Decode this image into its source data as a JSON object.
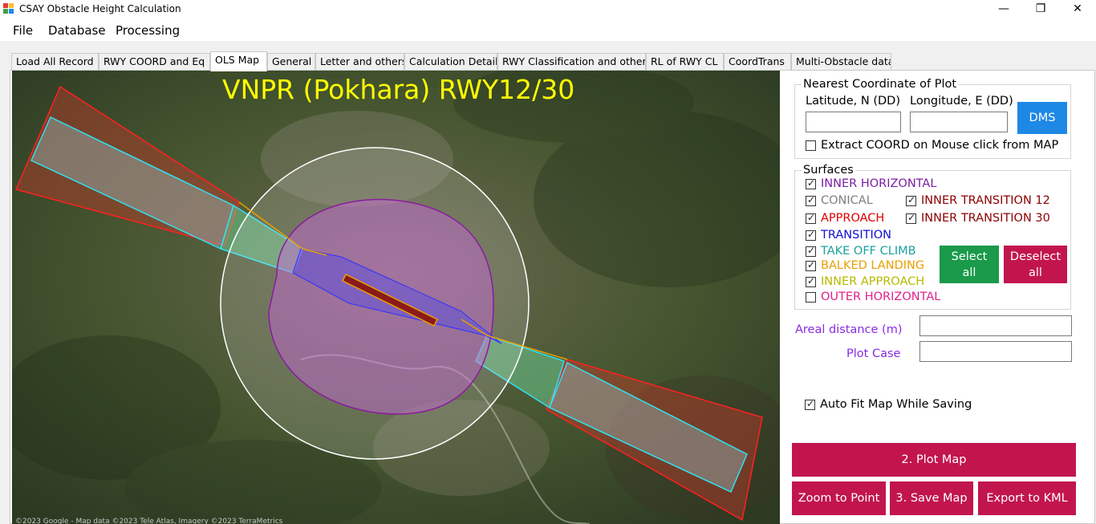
{
  "window": {
    "title": "CSAY Obstacle Height Calculation",
    "controls": {
      "minimize": "—",
      "maximize": "❐",
      "close": "✕"
    }
  },
  "menu": [
    "File",
    "Database",
    "Processing"
  ],
  "tabs": [
    "Load All Record",
    "RWY COORD and Eq",
    "OLS Map",
    "General",
    "Letter and others",
    "Calculation Detail",
    "RWY Classification and other",
    "RL of RWY CL",
    "CoordTrans",
    "Multi-Obstacle data"
  ],
  "active_tab": "OLS Map",
  "map": {
    "title": "VNPR (Pokhara) RWY12/30",
    "credit": "©2023 Google - Map data ©2023 Tele Atlas, Imagery ©2023 TerraMetrics"
  },
  "nearest": {
    "group_label": "Nearest Coordinate of Plot",
    "lat_label": "Latitude, N (DD)",
    "lon_label": "Longitude, E (DD)",
    "lat_value": "",
    "lon_value": "",
    "dms_button": "DMS",
    "extract_label": "Extract COORD on Mouse click from MAP",
    "extract_checked": false
  },
  "surfaces": {
    "group_label": "Surfaces",
    "items": [
      {
        "label": "INNER HORIZONTAL",
        "checked": true,
        "color": "#7a1fa2"
      },
      {
        "label": "CONICAL",
        "checked": true,
        "color": "#808080"
      },
      {
        "label": "INNER TRANSITION 12",
        "checked": true,
        "color": "#8b0000"
      },
      {
        "label": "APPROACH",
        "checked": true,
        "color": "#e00000"
      },
      {
        "label": "INNER TRANSITION 30",
        "checked": true,
        "color": "#8b0000"
      },
      {
        "label": "TRANSITION",
        "checked": true,
        "color": "#1010d0"
      },
      {
        "label": "TAKE OFF CLIMB",
        "checked": true,
        "color": "#1ea0a0"
      },
      {
        "label": "BALKED LANDING",
        "checked": true,
        "color": "#e8a000"
      },
      {
        "label": "INNER APPROACH",
        "checked": true,
        "color": "#b8b800"
      },
      {
        "label": "OUTER HORIZONTAL",
        "checked": false,
        "color": "#e0208a"
      }
    ],
    "select_all": "Select all",
    "deselect_all": "Deselect all"
  },
  "areal_distance": {
    "label": "Areal distance (m)",
    "value": ""
  },
  "plot_case": {
    "label": "Plot Case",
    "value": ""
  },
  "auto_fit": {
    "label": "Auto Fit Map While Saving",
    "checked": true
  },
  "actions": {
    "plot_map": "2. Plot Map",
    "zoom_to_point": "Zoom to Point",
    "save_map": "3. Save Map",
    "export_kml": "Export to KML"
  },
  "colors": {
    "accent_button": "#c2154e",
    "dms_button": "#1e88e5",
    "select_all": "#1a9a4a",
    "deselect_all": "#c2154e",
    "label_purple": "#8a2be2",
    "map_title": "#ffff00"
  }
}
